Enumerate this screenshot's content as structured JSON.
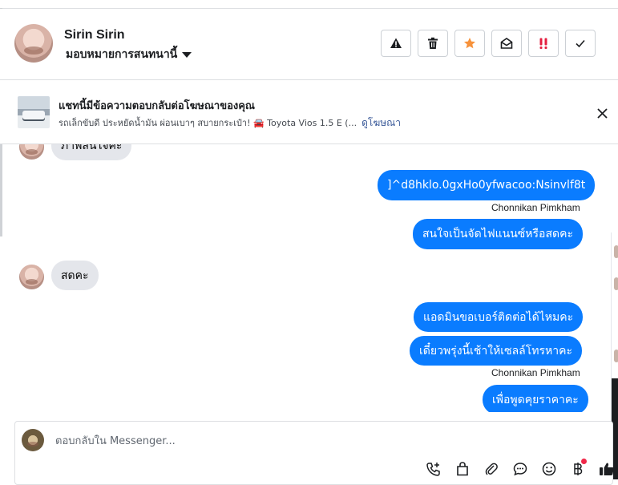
{
  "header": {
    "contact_name": "Sirin Sirin",
    "assign_label": "มอบหมายการสนทนานี้",
    "actions": [
      {
        "name": "report-spam-button",
        "icon": "warning-icon"
      },
      {
        "name": "delete-button",
        "icon": "trash-icon"
      },
      {
        "name": "star-button",
        "icon": "star-icon",
        "color": "#f7923b"
      },
      {
        "name": "mark-unread-button",
        "icon": "envelope-open-icon"
      },
      {
        "name": "follow-up-button",
        "icon": "double-exclamation-icon",
        "color": "#e41e3f"
      },
      {
        "name": "mark-done-button",
        "icon": "check-icon"
      }
    ]
  },
  "ad": {
    "title": "แชทนี้มีข้อความตอบกลับต่อโฆษณาของคุณ",
    "description": "รถเล็กขับดี ประหยัดน้ำมัน ผ่อนเบาๆ สบายกระเป๋า! 🚘 Toyota Vios 1.5 E (...",
    "link_label": "ดูโฆษณา"
  },
  "messages": [
    {
      "direction": "in",
      "text": "ภาพสนใจคะ"
    },
    {
      "direction": "out",
      "text": "]^d8hklo.0gxHo0yfwacoo:Nsinvlf8t"
    },
    {
      "direction": "sender",
      "text": "Chonnikan Pimkham"
    },
    {
      "direction": "out",
      "text": "สนใจเป็นจัดไฟแนนซ์หรือสดคะ"
    },
    {
      "direction": "in",
      "text": "สดคะ"
    },
    {
      "direction": "out",
      "text": "แอดมินขอเบอร์ติดต่อได้ไหมคะ"
    },
    {
      "direction": "out",
      "text": "เดี๋ยวพรุ่งนี้เช้าให้เซลล์โทรหาคะ"
    },
    {
      "direction": "sender",
      "text": "Chonnikan Pimkham"
    },
    {
      "direction": "out",
      "text": "เพื่อพูดคุยราคาคะ"
    }
  ],
  "composer": {
    "placeholder": "ตอบกลับใน Messenger...",
    "tools": [
      "add-call-icon",
      "shopping-bag-icon",
      "paperclip-icon",
      "speech-bubble-icon",
      "smiley-icon",
      "baht-icon",
      "thumbs-up-icon"
    ]
  },
  "colors": {
    "outgoing_bubble": "#0a7cff",
    "incoming_bubble": "#e4e6eb",
    "link": "#385898"
  }
}
